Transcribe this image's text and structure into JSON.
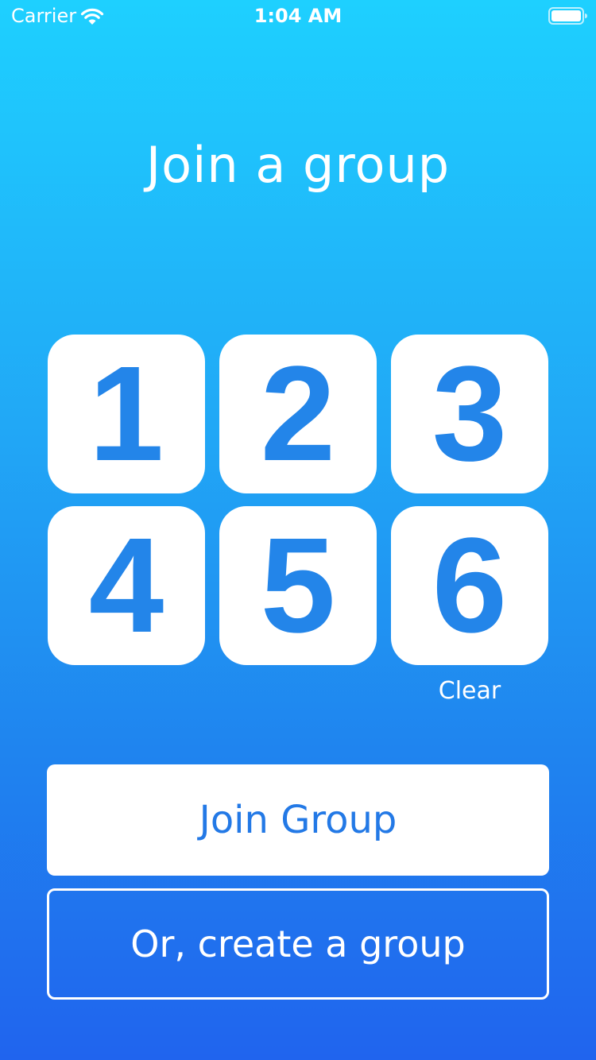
{
  "status_bar": {
    "carrier": "Carrier",
    "time": "1:04 AM",
    "wifi_icon": "wifi-icon",
    "battery_icon": "battery-icon"
  },
  "title": "Join a group",
  "code": {
    "digits": [
      "1",
      "2",
      "3",
      "4",
      "5",
      "6"
    ],
    "clear_label": "Clear"
  },
  "actions": {
    "join_label": "Join Group",
    "create_label": "Or, create a group"
  },
  "colors": {
    "gradient_top": "#1ed0ff",
    "gradient_bottom": "#2064ee",
    "accent_blue": "#2385e9",
    "tile_background": "#ffffff"
  }
}
